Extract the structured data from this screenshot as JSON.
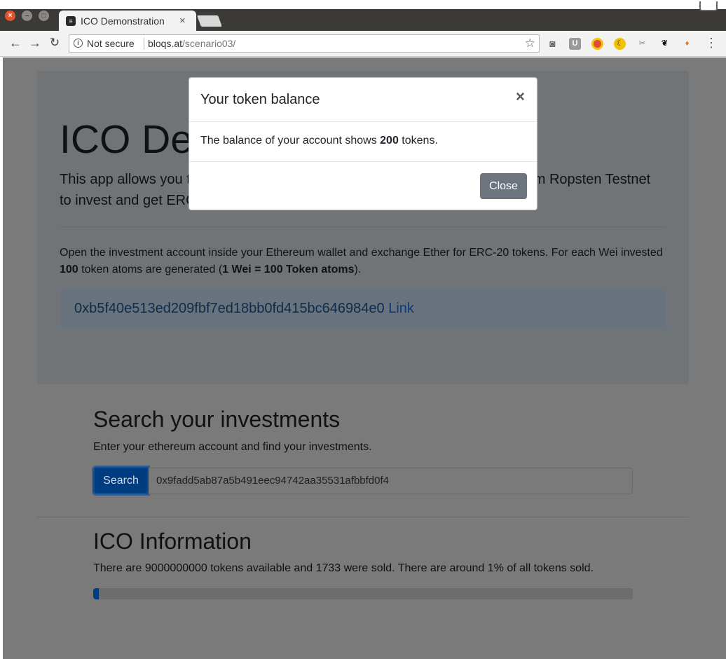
{
  "browser": {
    "tab_title": "ICO Demonstration",
    "tab_close": "×",
    "security_label": "Not secure",
    "url_host": "bloqs.at",
    "url_path": "/scenario03/"
  },
  "jumbotron": {
    "title": "ICO De",
    "lead_line1_start": "This app allows you t",
    "lead_line1_end": "m Ropsten Testnet",
    "lead_line2": "to invest and get ERC",
    "desc_part1": "Open the investment account inside your Ethereum wallet and exchange Ether for ERC-20 tokens. For each Wei invested",
    "desc_bold1": "100",
    "desc_part2": " token atoms are generated (",
    "desc_bold2": "1 Wei = 100 Token atoms",
    "desc_part3": ").",
    "address": "0xb5f40e513ed209fbf7ed18bb0fd415bc646984e0",
    "address_link": "Link"
  },
  "search": {
    "title": "Search your investments",
    "subtitle": "Enter your ethereum account and find your investments.",
    "button_label": "Search",
    "input_value": "0x9fadd5ab87a5b491eec94742aa35531afbbfd0f4"
  },
  "ico_info": {
    "title": "ICO Information",
    "text": "There are 9000000000 tokens available and 1733 were sold. There are around 1% of all tokens sold.",
    "progress_percent": 1
  },
  "modal": {
    "title": "Your token balance",
    "close_x": "×",
    "body_prefix": "The balance of your account shows ",
    "balance": "200",
    "body_suffix": " tokens.",
    "close_label": "Close"
  },
  "colors": {
    "primary": "#007bff",
    "secondary": "#6c757d"
  }
}
